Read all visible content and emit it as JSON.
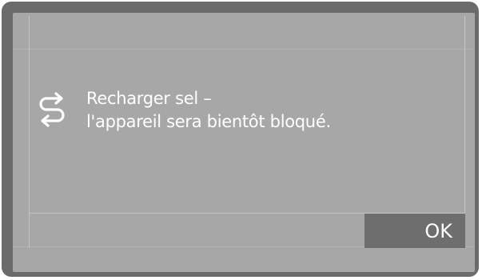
{
  "dialog": {
    "icon": "salt-refill-arrows-icon",
    "message_line1": "Recharger sel –",
    "message_line2": "l'appareil sera bientôt bloqué.",
    "ok_label": "OK"
  },
  "colors": {
    "frame": "#6b6b6b",
    "screen": "#a7a7a7",
    "button": "#6e6e6e",
    "text": "#ffffff"
  }
}
